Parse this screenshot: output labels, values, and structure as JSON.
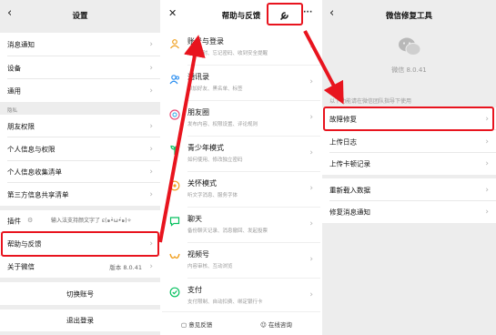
{
  "settings": {
    "title": "设置",
    "items": [
      {
        "label": "消息通知"
      },
      {
        "label": "设备"
      },
      {
        "label": "通用"
      }
    ],
    "privacy_section": "隐私",
    "privacy_items": [
      {
        "label": "朋友权限"
      },
      {
        "label": "个人信息与权限"
      },
      {
        "label": "个人信息收集清单"
      },
      {
        "label": "第三方信息共享清单"
      }
    ],
    "plugins": {
      "label": "插件",
      "hint": "输入法支持颜文字了 ε(๑•̀ω•́๑)✧"
    },
    "help": {
      "label": "帮助与反馈"
    },
    "about": {
      "label": "关于微信",
      "version": "版本 8.0.41"
    },
    "switch_account": "切换账号",
    "logout": "退出登录"
  },
  "help": {
    "title": "帮助与反馈",
    "items": [
      {
        "title": "账号与登录",
        "subtitle": "账号解封、忘记密码、收到安全提醒",
        "icon": "person-icon"
      },
      {
        "title": "通讯录",
        "subtitle": "添加好友、黑名单、标签",
        "icon": "contacts-icon"
      },
      {
        "title": "朋友圈",
        "subtitle": "发布内容、权限设置、评论规则",
        "icon": "moments-icon"
      },
      {
        "title": "青少年模式",
        "subtitle": "如何使用、修改独立密码",
        "icon": "sprout-icon"
      },
      {
        "title": "关怀模式",
        "subtitle": "听文字消息、服务字体",
        "icon": "care-icon"
      },
      {
        "title": "聊天",
        "subtitle": "备份聊天记录、消息撤回、发起投票",
        "icon": "chat-icon"
      },
      {
        "title": "视频号",
        "subtitle": "内容审核、互动浏览",
        "icon": "channels-icon"
      },
      {
        "title": "支付",
        "subtitle": "支付限制、自动扣费、绑定银行卡",
        "icon": "pay-icon"
      }
    ],
    "feedback": "意见反馈",
    "consult": "在线咨询"
  },
  "repair": {
    "title": "微信修复工具",
    "version": "微信 8.0.41",
    "hint": "以下功能请在微信团队指导下使用",
    "items": [
      {
        "label": "故障修复"
      },
      {
        "label": "上传日志"
      },
      {
        "label": "上传卡顿记录"
      }
    ],
    "items2": [
      {
        "label": "重新载入数据"
      },
      {
        "label": "修复消息通知"
      }
    ]
  },
  "colors": {
    "highlight": "#e8141e",
    "wechat_green": "#07c160"
  }
}
